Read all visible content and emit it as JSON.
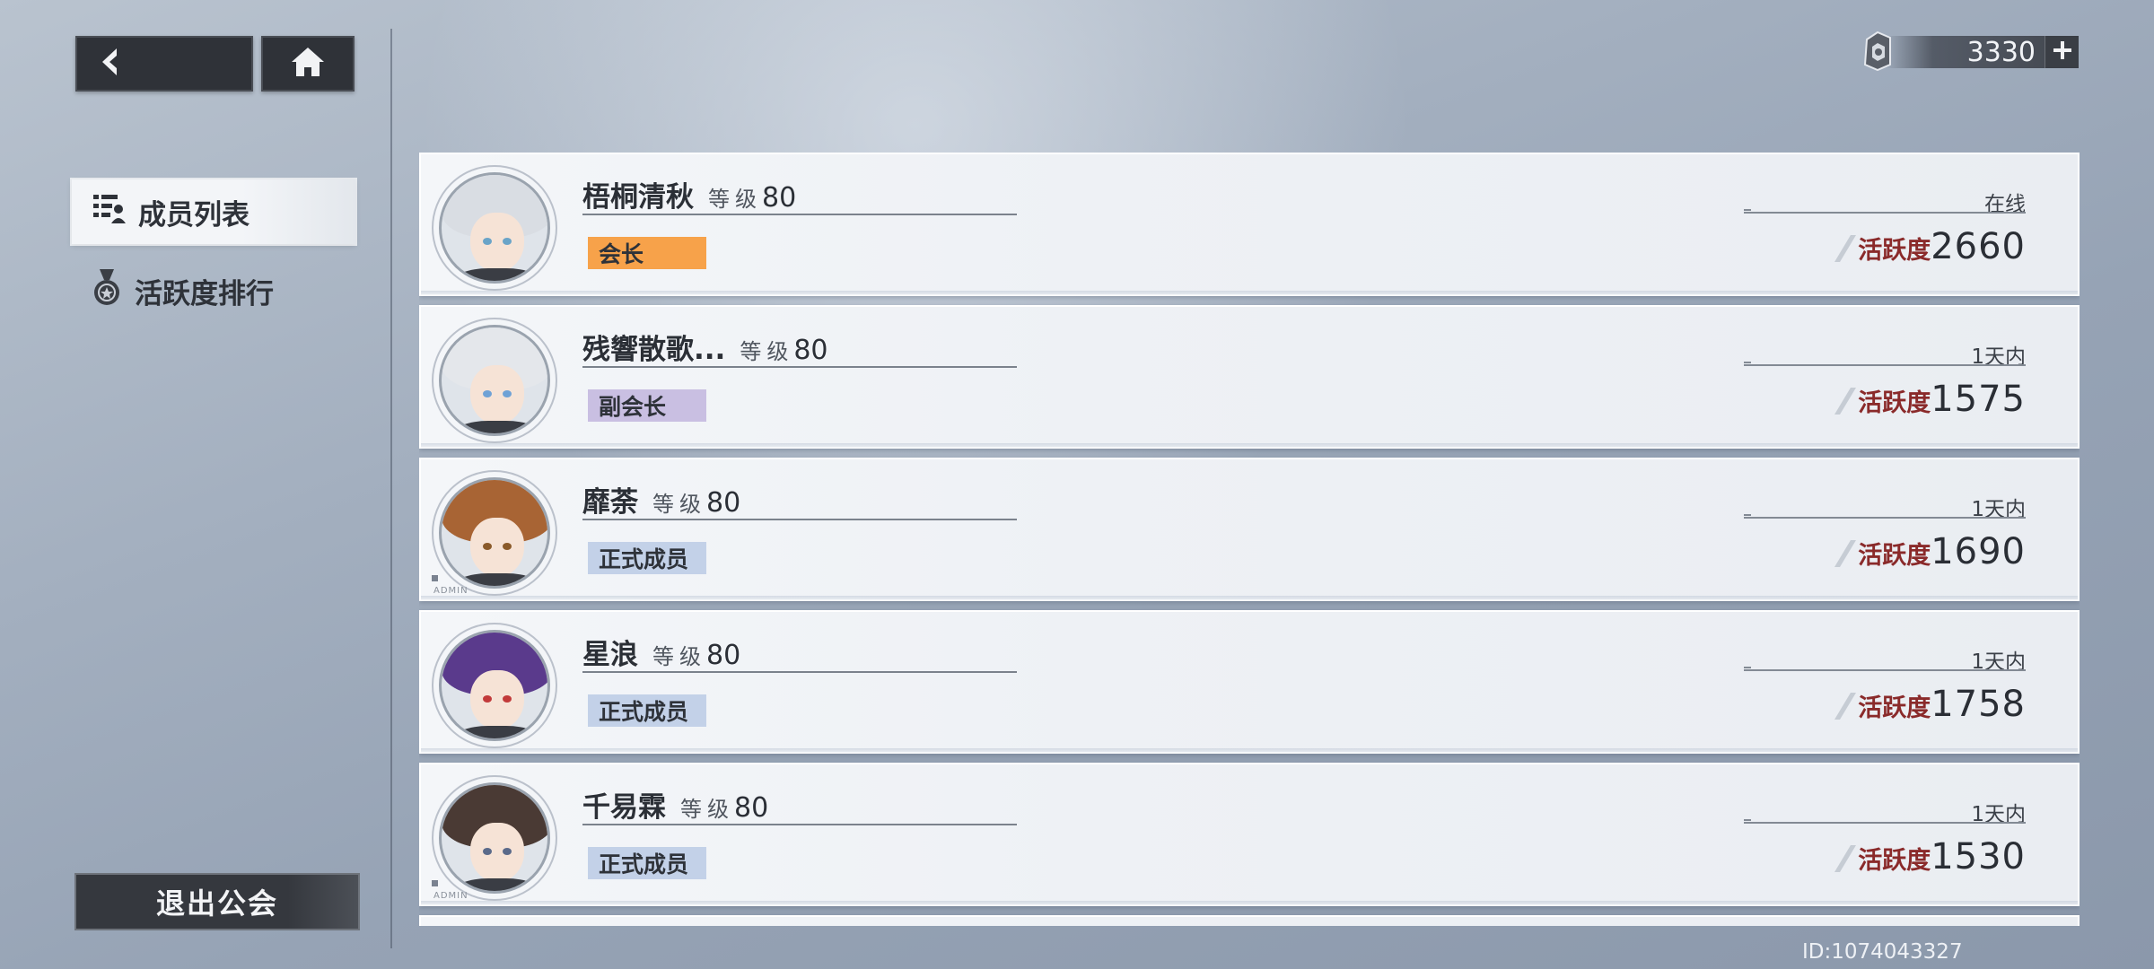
{
  "nav": {
    "back_icon": "chevron-left-icon",
    "home_icon": "home-icon"
  },
  "sidebar": {
    "tabs": [
      {
        "label": "成员列表",
        "icon": "member-list-icon",
        "active": true
      },
      {
        "label": "活跃度排行",
        "icon": "medal-icon",
        "active": false
      }
    ],
    "exit_label": "退出公会"
  },
  "currency": {
    "icon": "guild-token-icon",
    "amount": "3330",
    "plus_icon": "plus-icon"
  },
  "members": [
    {
      "name": "梧桐清秋",
      "level_label": "等级",
      "level": "80",
      "role": "会长",
      "role_color": "#f7a24a",
      "status": "在线",
      "activity_label": "活跃度",
      "activity": "2660",
      "hair": "#d9dde3",
      "eye": "#6aa4c8"
    },
    {
      "name": "残響散歌...",
      "level_label": "等级",
      "level": "80",
      "role": "副会长",
      "role_color": "#c9bfe2",
      "status": "1天内",
      "activity_label": "活跃度",
      "activity": "1575",
      "hair": "#e4e7eb",
      "eye": "#6fa2d6"
    },
    {
      "name": "靡荼",
      "level_label": "等级",
      "level": "80",
      "role": "正式成员",
      "role_color": "#c3d1e8",
      "status": "1天内",
      "activity_label": "活跃度",
      "activity": "1690",
      "hair": "#a86434",
      "eye": "#8a5a2a"
    },
    {
      "name": "星浪",
      "level_label": "等级",
      "level": "80",
      "role": "正式成员",
      "role_color": "#c3d1e8",
      "status": "1天内",
      "activity_label": "活跃度",
      "activity": "1758",
      "hair": "#5a3a8c",
      "eye": "#c23a3a"
    },
    {
      "name": "千易霖",
      "level_label": "等级",
      "level": "80",
      "role": "正式成员",
      "role_color": "#c3d1e8",
      "status": "1天内",
      "activity_label": "活跃度",
      "activity": "1530",
      "hair": "#4a3a34",
      "eye": "#5a6a8a"
    }
  ],
  "footer": {
    "id_text": "ID:1074043327"
  }
}
